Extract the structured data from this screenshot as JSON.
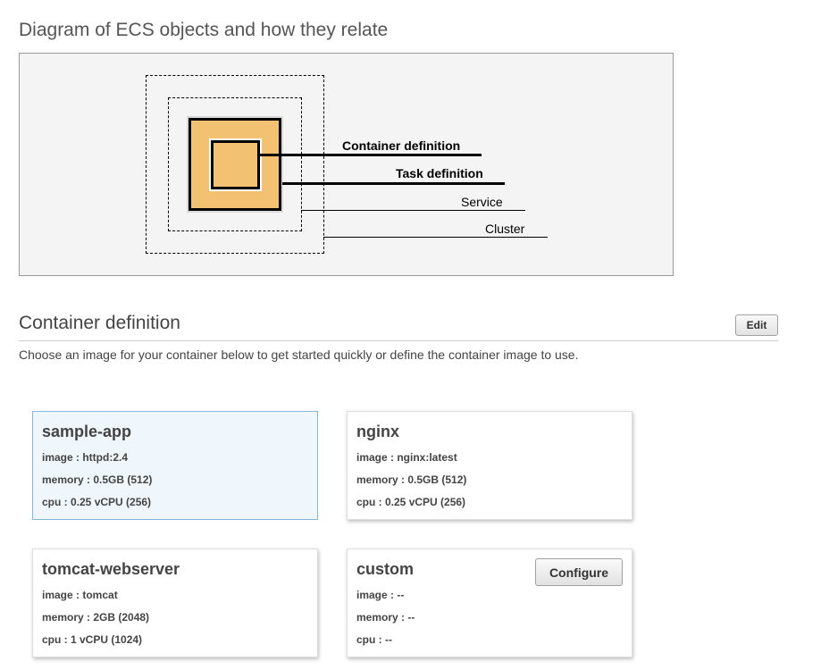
{
  "diagram": {
    "heading": "Diagram of ECS objects and how they relate",
    "labels": {
      "container_definition": "Container definition",
      "task_definition": "Task definition",
      "service": "Service",
      "cluster": "Cluster"
    },
    "colors": {
      "box_fill": "#f3c172",
      "panel_bg": "#f4f4f4"
    }
  },
  "section": {
    "heading": "Container definition",
    "edit_label": "Edit",
    "description": "Choose an image for your container below to get started quickly or define the container image to use."
  },
  "cards": [
    {
      "title": "sample-app",
      "image": "image : httpd:2.4",
      "memory": "memory :  0.5GB (512)",
      "cpu": "cpu :  0.25 vCPU (256)",
      "selected": true
    },
    {
      "title": "nginx",
      "image": "image : nginx:latest",
      "memory": "memory :  0.5GB (512)",
      "cpu": "cpu :  0.25 vCPU (256)",
      "selected": false
    },
    {
      "title": "tomcat-webserver",
      "image": "image : tomcat",
      "memory": "memory :  2GB (2048)",
      "cpu": "cpu :  1 vCPU (1024)",
      "selected": false
    },
    {
      "title": "custom",
      "image": "image : --",
      "memory": "memory :  --",
      "cpu": "cpu :  --",
      "configure_label": "Configure",
      "selected": false
    }
  ],
  "colors": {
    "selected_card_bg": "#eff7fd",
    "selected_card_border": "#80b8df"
  }
}
